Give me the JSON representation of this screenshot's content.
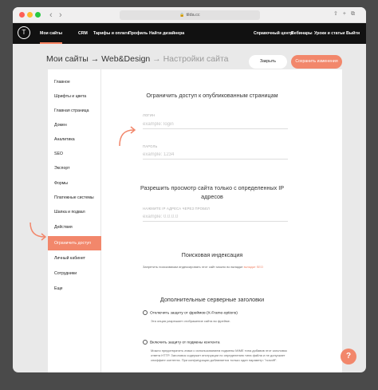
{
  "browser": {
    "url": "tilda.cc",
    "back_icon": "chevron-left-icon",
    "forward_icon": "chevron-right-icon"
  },
  "appbar": {
    "logo": "T",
    "nav_left": [
      "Мои сайты",
      "CRM",
      "Тарифы и оплата",
      "Профиль",
      "Найти дизайнера"
    ],
    "nav_right": [
      "Справочный центр",
      "Вебинары",
      "Уроки и статьи",
      "Выйти"
    ]
  },
  "title": {
    "part1": "Мои сайты",
    "sep1": " → ",
    "part2": "Web&Design",
    "sep2": " → ",
    "part3": "Настройки сайта"
  },
  "actions": {
    "close": "Закрыть",
    "save": "Сохранить изменения"
  },
  "sidebar": {
    "items": [
      "Главное",
      "Шрифты и цвета",
      "Главная страница",
      "Домен",
      "Аналитика",
      "SEO",
      "Экспорт",
      "Формы",
      "Платежные системы",
      "Шапка и подвал",
      "Действия",
      "Ограничить доступ",
      "Личный кабинет",
      "Сотрудники",
      "Еще"
    ],
    "active_index": 11
  },
  "main": {
    "restrict_title": "Ограничить доступ к опубликованным страницам",
    "login_label": "ЛОГИН",
    "login_placeholder": "example: login",
    "password_label": "ПАРОЛЬ",
    "password_placeholder": "example: 1234",
    "ip_title": "Разрешить просмотр сайта только с определенных IP адресов",
    "ip_label": "НАЖМИТЕ IP АДРЕСА ЧЕРЕЗ ПРОБЕЛ",
    "ip_placeholder": "example: 0.0.0.0",
    "indexing_title": "Поисковая индексация",
    "indexing_note": "Запретить поисковикам индексировать этот сайт можно во вкладке",
    "indexing_link": "вкладке SEO",
    "headers_title": "Дополнительные серверные заголовки",
    "opt1_label": "Отключить защиту от фреймов (X-Frame-options)",
    "opt1_note": "Эта опция разрешает отображение сайта во фрейме.",
    "opt2_label": "Включить защиту от подмены контента",
    "opt2_note": "Можно предотвратить атаки с использованием подмены MIME типа добавив этот заголовок ответа HTTP. Заголовок содержит инструкции по определению типа файла и не допускает сниффинг контента. При конфигурации добавляется только один параметр: \"nosniff\"."
  },
  "help": "?",
  "colors": {
    "accent": "#f2876b",
    "header": "#111111",
    "background": "#e9e9e9"
  }
}
